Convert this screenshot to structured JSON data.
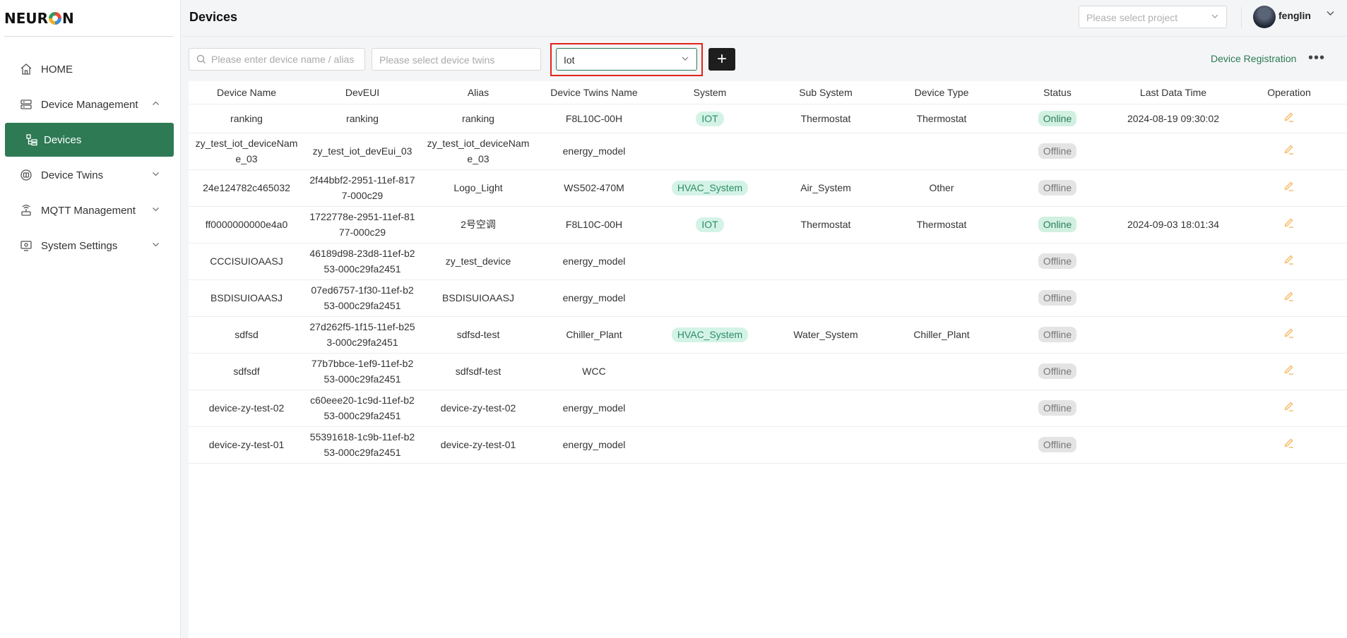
{
  "app": {
    "logo_text_left": "NEUR",
    "logo_text_right": "N"
  },
  "sidebar": {
    "items": [
      {
        "label": "HOME",
        "icon": "home-icon"
      },
      {
        "label": "Device Management",
        "icon": "server-icon",
        "expanded": true
      },
      {
        "label": "Devices",
        "icon": "devices-icon",
        "active": true
      },
      {
        "label": "Device Twins",
        "icon": "twins-icon"
      },
      {
        "label": "MQTT Management",
        "icon": "router-icon"
      },
      {
        "label": "System Settings",
        "icon": "monitor-icon"
      }
    ]
  },
  "header": {
    "title": "Devices",
    "project_placeholder": "Please select project",
    "username": "fenglin"
  },
  "filters": {
    "search_placeholder": "Please enter device name / alias",
    "twins_placeholder": "Please select device twins",
    "system_value": "Iot",
    "add_label": "+",
    "registration_label": "Device Registration",
    "more_label": "•••"
  },
  "colors": {
    "accent": "#2d7a54",
    "highlight": "#e2231a",
    "edit": "#f5b860"
  },
  "table": {
    "columns": [
      "Device Name",
      "DevEUI",
      "Alias",
      "Device Twins Name",
      "System",
      "Sub System",
      "Device Type",
      "Status",
      "Last Data Time",
      "Operation"
    ],
    "rows": [
      {
        "name": "ranking",
        "deveui": "ranking",
        "alias": "ranking",
        "twins": "F8L10C-00H",
        "system": "IOT",
        "subsystem": "Thermostat",
        "type": "Thermostat",
        "status": "Online",
        "time": "2024-08-19 09:30:02"
      },
      {
        "name": "zy_test_iot_deviceName_03",
        "deveui": "zy_test_iot_devEui_03",
        "alias": "zy_test_iot_deviceName_03",
        "twins": "energy_model",
        "system": "",
        "subsystem": "",
        "type": "",
        "status": "Offline",
        "time": ""
      },
      {
        "name": "24e124782c465032",
        "deveui": "2f44bbf2-2951-11ef-8177-000c29",
        "alias": "Logo_Light",
        "twins": "WS502-470M",
        "system": "HVAC_System",
        "subsystem": "Air_System",
        "type": "Other",
        "status": "Offline",
        "time": ""
      },
      {
        "name": "ff0000000000e4a0",
        "deveui": "1722778e-2951-11ef-8177-000c29",
        "alias": "2号空调",
        "twins": "F8L10C-00H",
        "system": "IOT",
        "subsystem": "Thermostat",
        "type": "Thermostat",
        "status": "Online",
        "time": "2024-09-03 18:01:34"
      },
      {
        "name": "CCCISUIOAASJ",
        "deveui": "46189d98-23d8-11ef-b253-000c29fa2451",
        "alias": "zy_test_device",
        "twins": "energy_model",
        "system": "",
        "subsystem": "",
        "type": "",
        "status": "Offline",
        "time": ""
      },
      {
        "name": "BSDISUIOAASJ",
        "deveui": "07ed6757-1f30-11ef-b253-000c29fa2451",
        "alias": "BSDISUIOAASJ",
        "twins": "energy_model",
        "system": "",
        "subsystem": "",
        "type": "",
        "status": "Offline",
        "time": ""
      },
      {
        "name": "sdfsd",
        "deveui": "27d262f5-1f15-11ef-b253-000c29fa2451",
        "alias": "sdfsd-test",
        "twins": "Chiller_Plant",
        "system": "HVAC_System",
        "subsystem": "Water_System",
        "type": "Chiller_Plant",
        "status": "Offline",
        "time": ""
      },
      {
        "name": "sdfsdf",
        "deveui": "77b7bbce-1ef9-11ef-b253-000c29fa2451",
        "alias": "sdfsdf-test",
        "twins": "WCC",
        "system": "",
        "subsystem": "",
        "type": "",
        "status": "Offline",
        "time": ""
      },
      {
        "name": "device-zy-test-02",
        "deveui": "c60eee20-1c9d-11ef-b253-000c29fa2451",
        "alias": "device-zy-test-02",
        "twins": "energy_model",
        "system": "",
        "subsystem": "",
        "type": "",
        "status": "Offline",
        "time": ""
      },
      {
        "name": "device-zy-test-01",
        "deveui": "55391618-1c9b-11ef-b253-000c29fa2451",
        "alias": "device-zy-test-01",
        "twins": "energy_model",
        "system": "",
        "subsystem": "",
        "type": "",
        "status": "Offline",
        "time": ""
      }
    ]
  }
}
